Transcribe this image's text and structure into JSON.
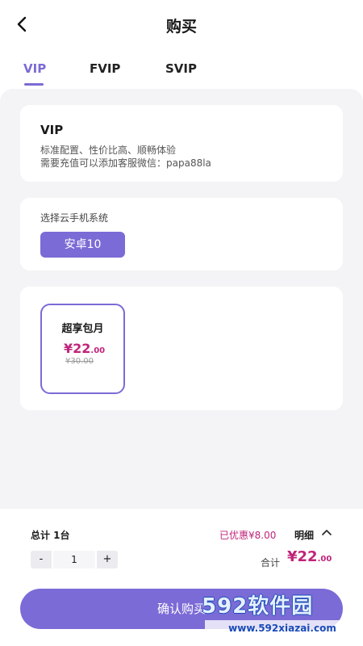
{
  "header": {
    "title": "购买",
    "back_icon": "chevron-left-icon"
  },
  "tabs": [
    {
      "label": "VIP",
      "active": true
    },
    {
      "label": "FVIP",
      "active": false
    },
    {
      "label": "SVIP",
      "active": false
    }
  ],
  "vip_card": {
    "name": "VIP",
    "desc_line1": "标准配置、性价比高、顺畅体验",
    "desc_line2": "需要充值可以添加客服微信：papa88la"
  },
  "system_card": {
    "label": "选择云手机系统",
    "selected": "安卓10"
  },
  "plans": [
    {
      "name": "超享包月",
      "currency": "¥",
      "price_int": "22",
      "price_dec": ".00",
      "original": "¥30.00",
      "selected": true
    }
  ],
  "bottom": {
    "total_label": "总计 1台",
    "discount_text": "已优惠¥8.00",
    "detail_label": "明细",
    "stepper": {
      "minus": "-",
      "value": "1",
      "plus": "+"
    },
    "sum_label": "合计",
    "sum_currency": "¥",
    "sum_int": "22",
    "sum_dec": ".00",
    "confirm_label": "确认购买"
  },
  "watermark": {
    "main": "592软件园",
    "sub": "www.592xiazai.com"
  },
  "colors": {
    "accent": "#7b6bd6",
    "price": "#c0247a",
    "background": "#f4f4f6"
  }
}
